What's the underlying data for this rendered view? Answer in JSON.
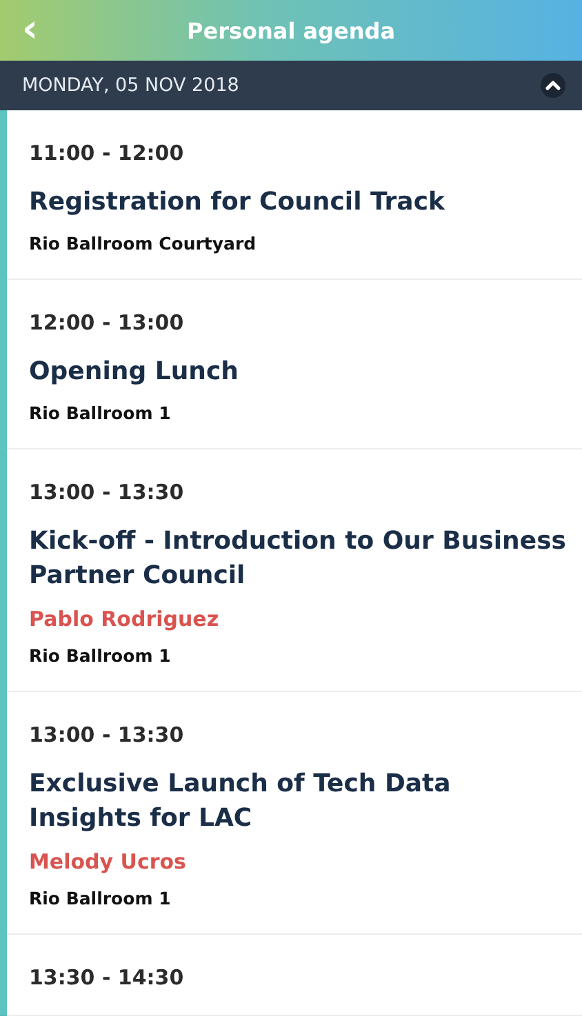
{
  "header": {
    "back_icon": "‹",
    "title": "Personal agenda"
  },
  "day": {
    "label": "MONDAY, 05 NOV 2018",
    "expanded": true
  },
  "sessions": [
    {
      "time": "11:00 - 12:00",
      "title": "Registration for Council Track",
      "location": "Rio Ballroom Courtyard"
    },
    {
      "time": "12:00 - 13:00",
      "title": "Opening Lunch",
      "location": "Rio Ballroom 1"
    },
    {
      "time": "13:00 - 13:30",
      "title": "Kick-off - Introduction to Our Business Partner Council",
      "speaker": "Pablo Rodriguez",
      "location": "Rio Ballroom 1"
    },
    {
      "time": "13:00 - 13:30",
      "title": "Exclusive Launch of Tech Data Insights for LAC",
      "speaker": "Melody Ucros",
      "location": "Rio Ballroom 1"
    },
    {
      "time": "13:30 - 14:30"
    }
  ]
}
